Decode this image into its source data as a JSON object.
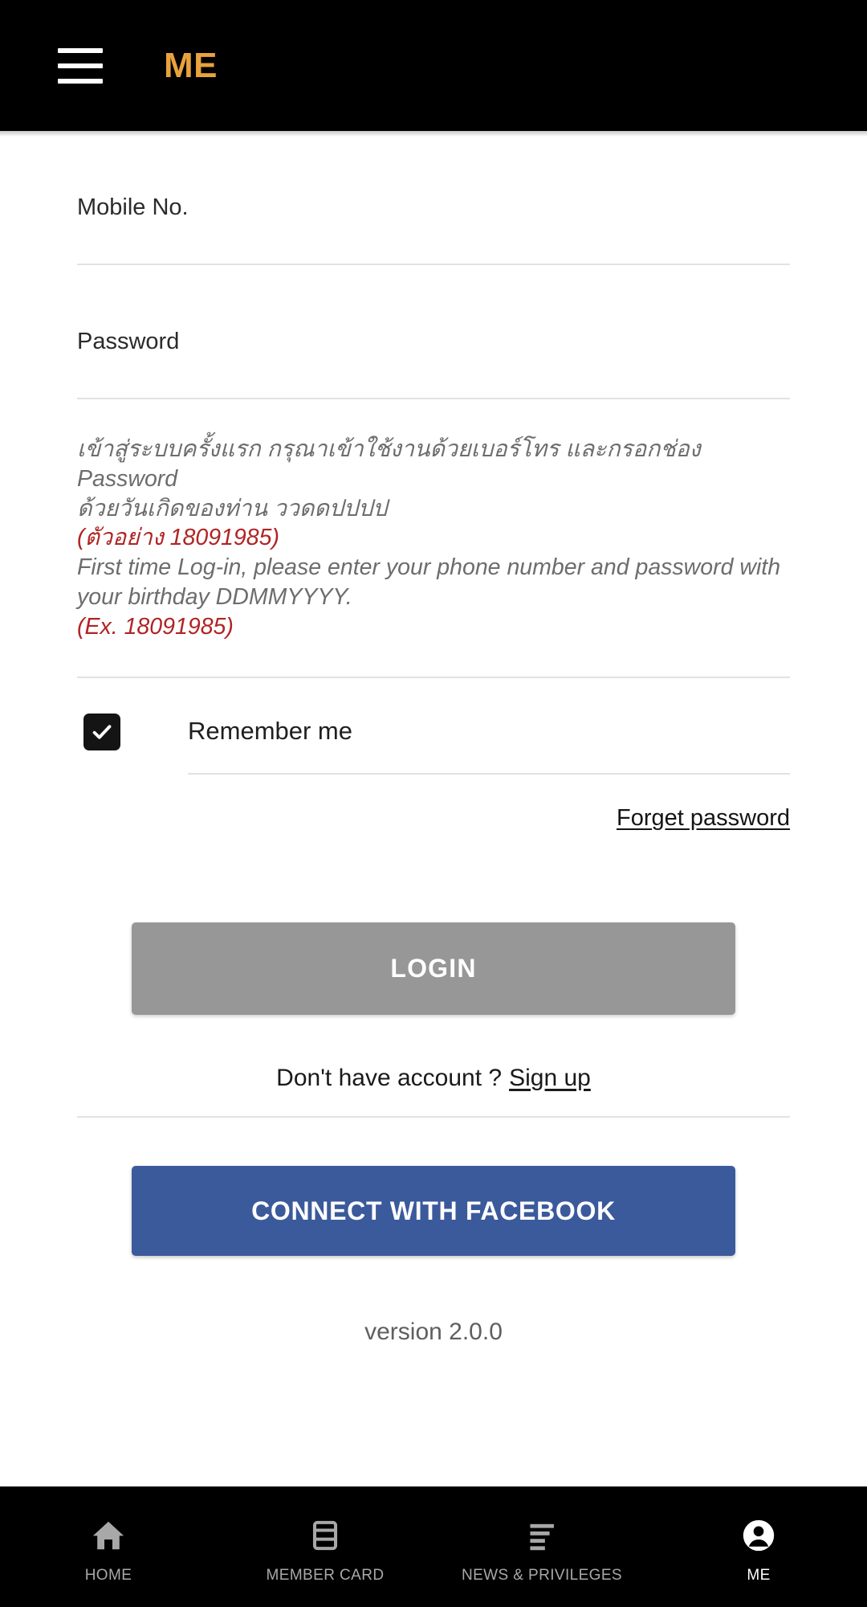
{
  "topbar": {
    "menu_icon": "hamburger-menu-icon",
    "brand": "ME"
  },
  "form": {
    "mobile": {
      "label": "Mobile No.",
      "value": "",
      "placeholder": ""
    },
    "password": {
      "label": "Password",
      "value": "",
      "placeholder": ""
    }
  },
  "instructions": {
    "thai_line1": "เข้าสู่ระบบครั้งแรก กรุณาเข้าใช้งานด้วยเบอร์โทร และกรอกช่อง Password",
    "thai_line2": "ด้วยวันเกิดของท่าน ววดดปปปป",
    "thai_example": "(ตัวอย่าง 18091985)",
    "eng_line1": "First time Log-in, please enter your phone number and password with",
    "eng_line2": "your birthday DDMMYYYY.",
    "eng_example": "(Ex. 18091985)",
    "example_color": "#b02424",
    "body_color": "#6d6d6d"
  },
  "remember": {
    "label": "Remember me",
    "checked": true,
    "checkbox_icon": "checkmark-icon"
  },
  "links": {
    "forget_password": "Forget password",
    "signup_prompt": "Don't have account ?",
    "signup": "Sign up"
  },
  "buttons": {
    "login": "LOGIN",
    "login_color": "#979797",
    "facebook": "CONNECT WITH FACEBOOK",
    "facebook_color": "#3b5a9b"
  },
  "footer": {
    "version": "version 2.0.0"
  },
  "bottomnav": {
    "items": [
      {
        "label": "HOME",
        "icon": "home-icon",
        "active": false
      },
      {
        "label": "MEMBER CARD",
        "icon": "card-icon",
        "active": false
      },
      {
        "label": "NEWS & PRIVILEGES",
        "icon": "list-icon",
        "active": false
      },
      {
        "label": "ME",
        "icon": "person-circle-icon",
        "active": true
      }
    ],
    "active_color": "#ffffff",
    "inactive_color": "#a8a8a8"
  }
}
